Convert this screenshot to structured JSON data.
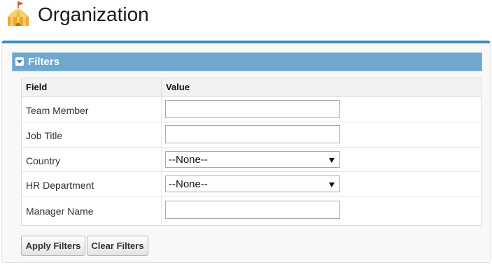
{
  "header": {
    "title": "Organization",
    "icon": "circus-tent-icon"
  },
  "filters": {
    "section_label": "Filters",
    "columns": {
      "field": "Field",
      "value": "Value"
    },
    "rows": [
      {
        "label": "Team Member",
        "type": "text",
        "value": ""
      },
      {
        "label": "Job Title",
        "type": "text",
        "value": ""
      },
      {
        "label": "Country",
        "type": "select",
        "value": "--None--"
      },
      {
        "label": "HR Department",
        "type": "select",
        "value": "--None--"
      },
      {
        "label": "Manager Name",
        "type": "text",
        "value": ""
      }
    ]
  },
  "buttons": {
    "apply": "Apply Filters",
    "clear": "Clear Filters"
  },
  "colors": {
    "panel_accent": "#3a8bc2",
    "filters_bar": "#6fa8cf"
  }
}
